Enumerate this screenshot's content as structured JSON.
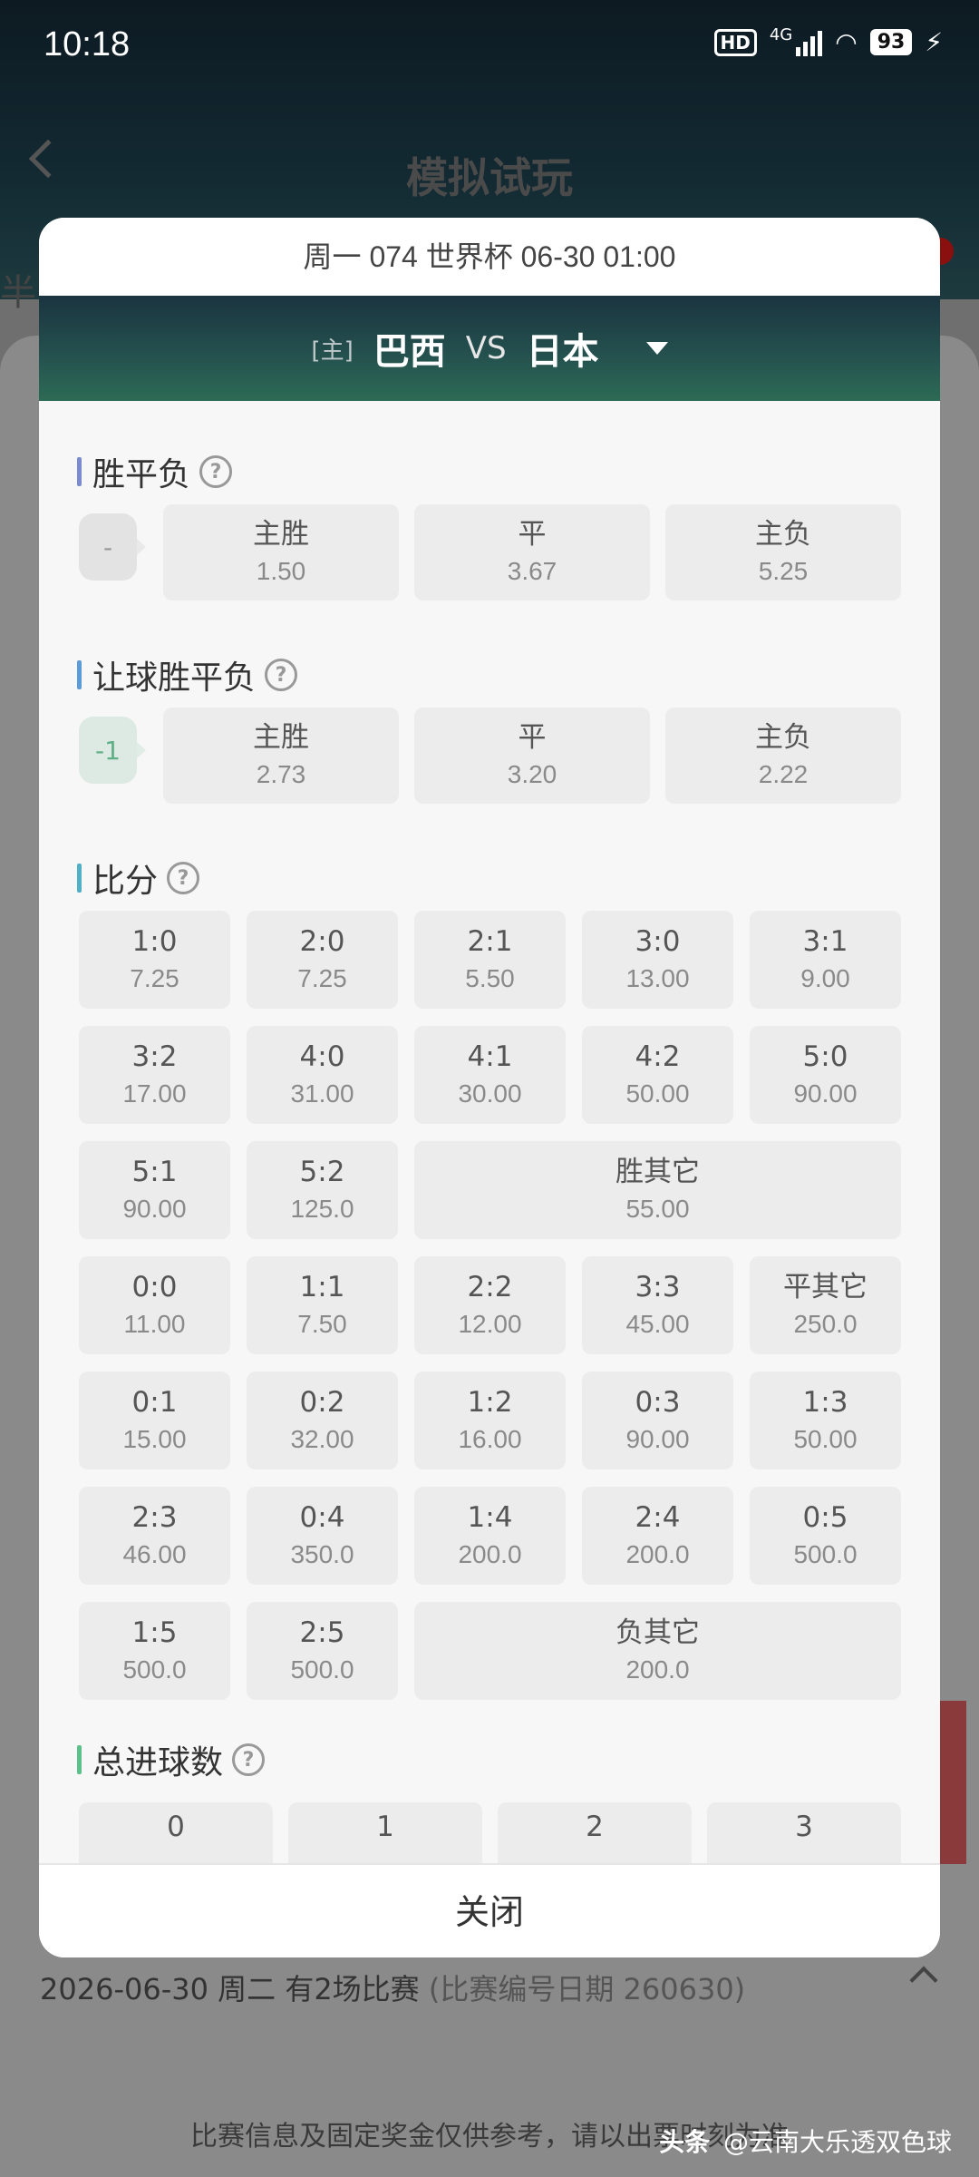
{
  "status": {
    "time": "10:18",
    "network": "4G",
    "hd": "HD",
    "battery": "93"
  },
  "background": {
    "title": "模拟试玩",
    "left_text": "半",
    "date_line": "2026-06-30 周二 有2场比赛",
    "date_sub": "(比赛编号日期 260630)",
    "disclaimer": "比赛信息及固定奖金仅供参考，请以出票时刻为准",
    "watermark_brand": "头条",
    "watermark_account": "@云南大乐透双色球"
  },
  "modal": {
    "header": "周一 074 世界杯 06-30 01:00",
    "home_tag": "[主]",
    "home_team": "巴西",
    "vs": "VS",
    "away_team": "日本",
    "close_label": "关闭",
    "help": "?",
    "spf": {
      "title": "胜平负",
      "handicap": "-",
      "options": [
        {
          "label": "主胜",
          "odds": "1.50"
        },
        {
          "label": "平",
          "odds": "3.67"
        },
        {
          "label": "主负",
          "odds": "5.25"
        }
      ]
    },
    "rqspf": {
      "title": "让球胜平负",
      "handicap": "-1",
      "options": [
        {
          "label": "主胜",
          "odds": "2.73"
        },
        {
          "label": "平",
          "odds": "3.20"
        },
        {
          "label": "主负",
          "odds": "2.22"
        }
      ]
    },
    "score": {
      "title": "比分",
      "rows": [
        [
          {
            "label": "1:0",
            "odds": "7.25"
          },
          {
            "label": "2:0",
            "odds": "7.25"
          },
          {
            "label": "2:1",
            "odds": "5.50"
          },
          {
            "label": "3:0",
            "odds": "13.00"
          },
          {
            "label": "3:1",
            "odds": "9.00"
          }
        ],
        [
          {
            "label": "3:2",
            "odds": "17.00"
          },
          {
            "label": "4:0",
            "odds": "31.00"
          },
          {
            "label": "4:1",
            "odds": "30.00"
          },
          {
            "label": "4:2",
            "odds": "50.00"
          },
          {
            "label": "5:0",
            "odds": "90.00"
          }
        ],
        [
          {
            "label": "5:1",
            "odds": "90.00"
          },
          {
            "label": "5:2",
            "odds": "125.0"
          },
          {
            "label": "胜其它",
            "odds": "55.00"
          }
        ],
        [
          {
            "label": "0:0",
            "odds": "11.00"
          },
          {
            "label": "1:1",
            "odds": "7.50"
          },
          {
            "label": "2:2",
            "odds": "12.00"
          },
          {
            "label": "3:3",
            "odds": "45.00"
          },
          {
            "label": "平其它",
            "odds": "250.0"
          }
        ],
        [
          {
            "label": "0:1",
            "odds": "15.00"
          },
          {
            "label": "0:2",
            "odds": "32.00"
          },
          {
            "label": "1:2",
            "odds": "16.00"
          },
          {
            "label": "0:3",
            "odds": "90.00"
          },
          {
            "label": "1:3",
            "odds": "50.00"
          }
        ],
        [
          {
            "label": "2:3",
            "odds": "46.00"
          },
          {
            "label": "0:4",
            "odds": "350.0"
          },
          {
            "label": "1:4",
            "odds": "200.0"
          },
          {
            "label": "2:4",
            "odds": "200.0"
          },
          {
            "label": "0:5",
            "odds": "500.0"
          }
        ],
        [
          {
            "label": "1:5",
            "odds": "500.0"
          },
          {
            "label": "2:5",
            "odds": "500.0"
          },
          {
            "label": "负其它",
            "odds": "200.0"
          }
        ]
      ]
    },
    "goals": {
      "title": "总进球数",
      "options": [
        {
          "label": "0"
        },
        {
          "label": "1"
        },
        {
          "label": "2"
        },
        {
          "label": "3"
        }
      ]
    }
  }
}
